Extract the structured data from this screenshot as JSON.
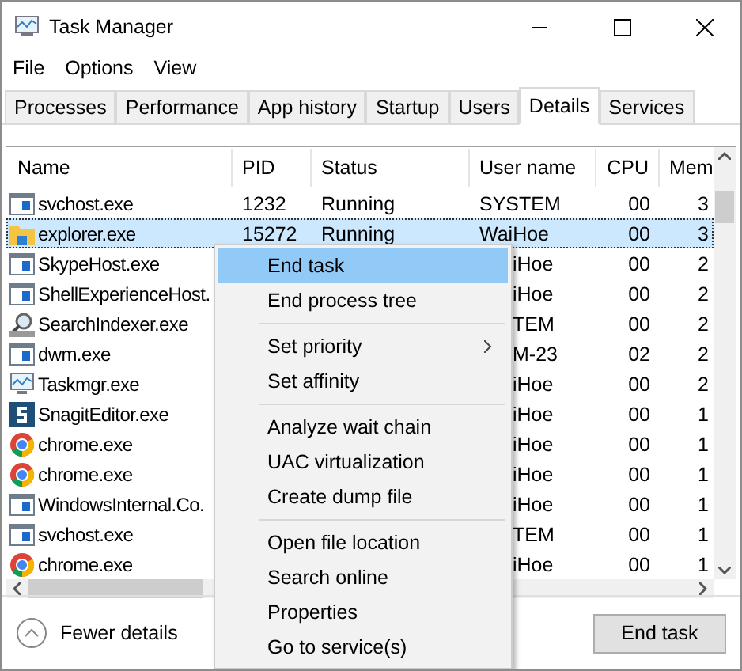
{
  "window": {
    "title": "Task Manager"
  },
  "menu_bar": [
    "File",
    "Options",
    "View"
  ],
  "tabs": [
    {
      "label": "Processes",
      "selected": false
    },
    {
      "label": "Performance",
      "selected": false
    },
    {
      "label": "App history",
      "selected": false
    },
    {
      "label": "Startup",
      "selected": false
    },
    {
      "label": "Users",
      "selected": false
    },
    {
      "label": "Details",
      "selected": true
    },
    {
      "label": "Services",
      "selected": false
    }
  ],
  "table": {
    "columns": [
      "Name",
      "PID",
      "Status",
      "User name",
      "CPU",
      "Mem"
    ],
    "rows": [
      {
        "kind": "window",
        "name": "svchost.exe",
        "pid": "1232",
        "status": "Running",
        "user": "SYSTEM",
        "cpu": "00",
        "mem": "3",
        "covered": false,
        "selected": false
      },
      {
        "kind": "folder",
        "name": "explorer.exe",
        "pid": "15272",
        "status": "Running",
        "user": "WaiHoe",
        "cpu": "00",
        "mem": "3",
        "covered": false,
        "selected": true
      },
      {
        "kind": "window",
        "name": "SkypeHost.exe",
        "user": "iHoe",
        "cpu": "00",
        "mem": "2",
        "covered": true,
        "selected": false
      },
      {
        "kind": "window",
        "name": "ShellExperienceHost.",
        "user": "iHoe",
        "cpu": "00",
        "mem": "2",
        "covered": true,
        "selected": false
      },
      {
        "kind": "search",
        "name": "SearchIndexer.exe",
        "user": "TEM",
        "cpu": "00",
        "mem": "2",
        "covered": true,
        "selected": false
      },
      {
        "kind": "window",
        "name": "dwm.exe",
        "user": "M-23",
        "cpu": "02",
        "mem": "2",
        "covered": true,
        "selected": false
      },
      {
        "kind": "monitor",
        "name": "Taskmgr.exe",
        "user": "iHoe",
        "cpu": "00",
        "mem": "2",
        "covered": true,
        "selected": false
      },
      {
        "kind": "s-logo",
        "name": "SnagitEditor.exe",
        "user": "iHoe",
        "cpu": "00",
        "mem": "1",
        "covered": true,
        "selected": false
      },
      {
        "kind": "chrome",
        "name": "chrome.exe",
        "user": "iHoe",
        "cpu": "00",
        "mem": "1",
        "covered": true,
        "selected": false
      },
      {
        "kind": "chrome",
        "name": "chrome.exe",
        "user": "iHoe",
        "cpu": "00",
        "mem": "1",
        "covered": true,
        "selected": false
      },
      {
        "kind": "window",
        "name": "WindowsInternal.Co.",
        "user": "iHoe",
        "cpu": "00",
        "mem": "1",
        "covered": true,
        "selected": false
      },
      {
        "kind": "window",
        "name": "svchost.exe",
        "user": "TEM",
        "cpu": "00",
        "mem": "1",
        "covered": true,
        "selected": false
      },
      {
        "kind": "chrome",
        "name": "chrome.exe",
        "user": "iHoe",
        "cpu": "00",
        "mem": "1",
        "covered": true,
        "selected": false
      }
    ]
  },
  "context_menu": {
    "groups": [
      [
        {
          "label": "End task",
          "selected": true,
          "submenu": false
        },
        {
          "label": "End process tree",
          "selected": false,
          "submenu": false
        }
      ],
      [
        {
          "label": "Set priority",
          "selected": false,
          "submenu": true
        },
        {
          "label": "Set affinity",
          "selected": false,
          "submenu": false
        }
      ],
      [
        {
          "label": "Analyze wait chain",
          "selected": false,
          "submenu": false
        },
        {
          "label": "UAC virtualization",
          "selected": false,
          "submenu": false
        },
        {
          "label": "Create dump file",
          "selected": false,
          "submenu": false
        }
      ],
      [
        {
          "label": "Open file location",
          "selected": false,
          "submenu": false
        },
        {
          "label": "Search online",
          "selected": false,
          "submenu": false
        },
        {
          "label": "Properties",
          "selected": false,
          "submenu": false
        },
        {
          "label": "Go to service(s)",
          "selected": false,
          "submenu": false
        }
      ]
    ]
  },
  "footer": {
    "toggle": "Fewer details",
    "button": "End task"
  }
}
